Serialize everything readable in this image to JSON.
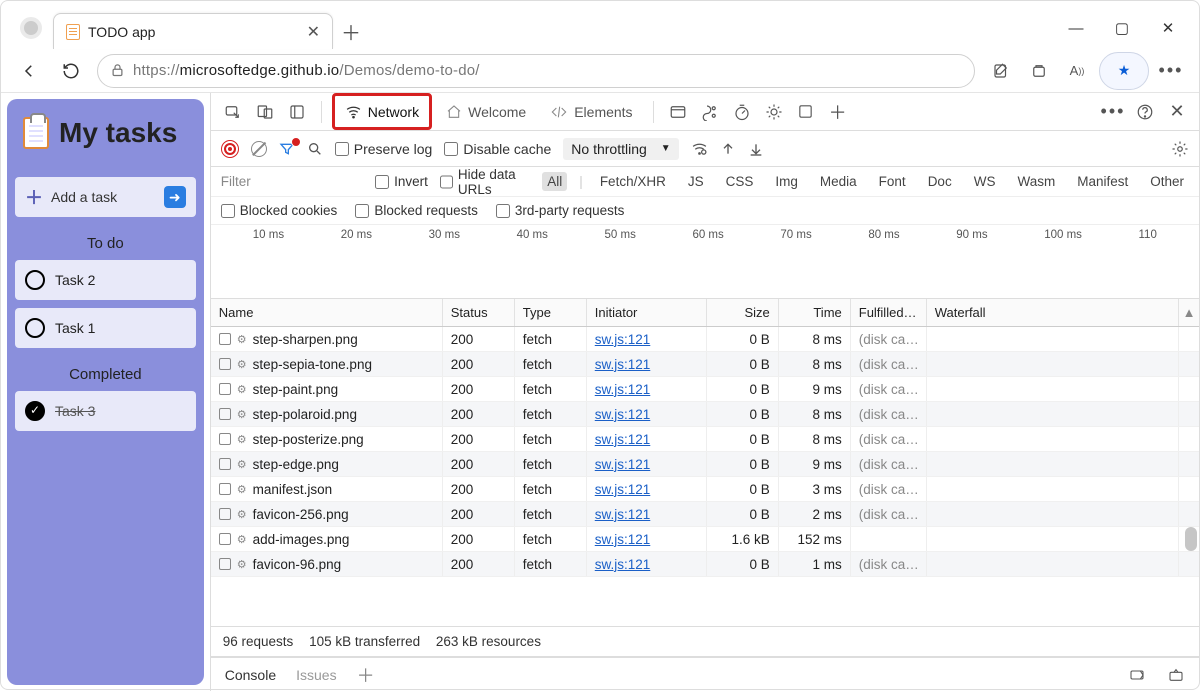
{
  "browser": {
    "tab_title": "TODO app",
    "url_display_prefix": "https://",
    "url_display_host": "microsoftedge.github.io",
    "url_display_path": "/Demos/demo-to-do/"
  },
  "app": {
    "title": "My tasks",
    "add_placeholder": "Add a task",
    "sections": {
      "todo": "To do",
      "completed": "Completed"
    },
    "tasks_todo": [
      "Task 2",
      "Task 1"
    ],
    "tasks_done": [
      "Task 3"
    ]
  },
  "devtools": {
    "tabs": {
      "network": "Network",
      "welcome": "Welcome",
      "elements": "Elements"
    },
    "toolbar": {
      "preserve_log": "Preserve log",
      "disable_cache": "Disable cache",
      "throttling": "No throttling"
    },
    "filter": {
      "placeholder": "Filter",
      "invert": "Invert",
      "hide_data_urls": "Hide data URLs",
      "types": [
        "All",
        "Fetch/XHR",
        "JS",
        "CSS",
        "Img",
        "Media",
        "Font",
        "Doc",
        "WS",
        "Wasm",
        "Manifest",
        "Other"
      ]
    },
    "filter2": {
      "blocked_cookies": "Blocked cookies",
      "blocked_requests": "Blocked requests",
      "third_party": "3rd-party requests"
    },
    "timeline_labels": [
      "10 ms",
      "20 ms",
      "30 ms",
      "40 ms",
      "50 ms",
      "60 ms",
      "70 ms",
      "80 ms",
      "90 ms",
      "100 ms",
      "110"
    ],
    "columns": {
      "name": "Name",
      "status": "Status",
      "type": "Type",
      "initiator": "Initiator",
      "size": "Size",
      "time": "Time",
      "fulfilled": "Fulfilled…",
      "waterfall": "Waterfall"
    },
    "rows": [
      {
        "name": "step-sharpen.png",
        "status": "200",
        "type": "fetch",
        "initiator": "sw.js:121",
        "size": "0 B",
        "time": "8 ms",
        "fulfilled": "(disk ca…"
      },
      {
        "name": "step-sepia-tone.png",
        "status": "200",
        "type": "fetch",
        "initiator": "sw.js:121",
        "size": "0 B",
        "time": "8 ms",
        "fulfilled": "(disk ca…"
      },
      {
        "name": "step-paint.png",
        "status": "200",
        "type": "fetch",
        "initiator": "sw.js:121",
        "size": "0 B",
        "time": "9 ms",
        "fulfilled": "(disk ca…"
      },
      {
        "name": "step-polaroid.png",
        "status": "200",
        "type": "fetch",
        "initiator": "sw.js:121",
        "size": "0 B",
        "time": "8 ms",
        "fulfilled": "(disk ca…"
      },
      {
        "name": "step-posterize.png",
        "status": "200",
        "type": "fetch",
        "initiator": "sw.js:121",
        "size": "0 B",
        "time": "8 ms",
        "fulfilled": "(disk ca…"
      },
      {
        "name": "step-edge.png",
        "status": "200",
        "type": "fetch",
        "initiator": "sw.js:121",
        "size": "0 B",
        "time": "9 ms",
        "fulfilled": "(disk ca…"
      },
      {
        "name": "manifest.json",
        "status": "200",
        "type": "fetch",
        "initiator": "sw.js:121",
        "size": "0 B",
        "time": "3 ms",
        "fulfilled": "(disk ca…"
      },
      {
        "name": "favicon-256.png",
        "status": "200",
        "type": "fetch",
        "initiator": "sw.js:121",
        "size": "0 B",
        "time": "2 ms",
        "fulfilled": "(disk ca…"
      },
      {
        "name": "add-images.png",
        "status": "200",
        "type": "fetch",
        "initiator": "sw.js:121",
        "size": "1.6 kB",
        "time": "152 ms",
        "fulfilled": ""
      },
      {
        "name": "favicon-96.png",
        "status": "200",
        "type": "fetch",
        "initiator": "sw.js:121",
        "size": "0 B",
        "time": "1 ms",
        "fulfilled": "(disk ca…"
      }
    ],
    "status_bar": {
      "requests": "96 requests",
      "transferred": "105 kB transferred",
      "resources": "263 kB resources"
    },
    "drawer": {
      "console": "Console",
      "issues": "Issues"
    }
  }
}
